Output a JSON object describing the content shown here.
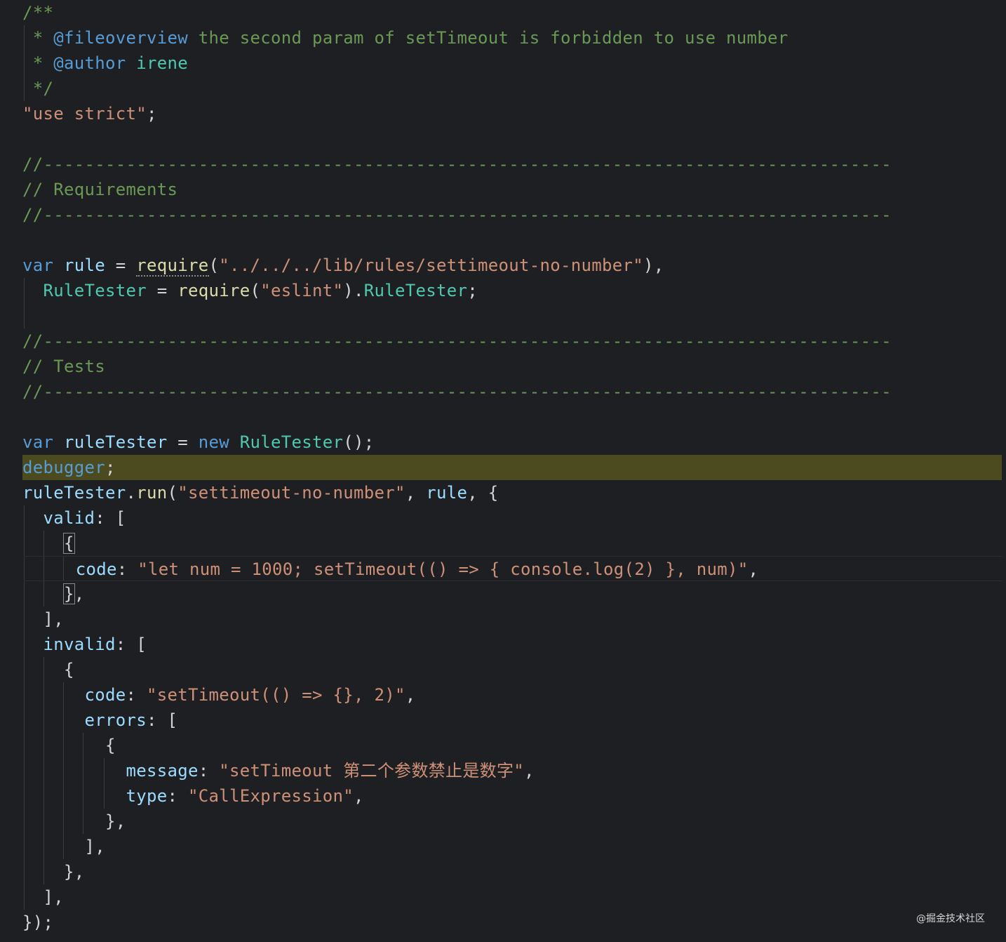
{
  "header_comment": {
    "open": "/**",
    "fileoverview_tag": "@fileoverview",
    "fileoverview_text": " the second param of setTimeout is forbidden to use number",
    "author_tag": "@author",
    "author_text": " irene",
    "close": " */"
  },
  "use_strict": "\"use strict\"",
  "separator": "//----------------------------------------------------------------------------------",
  "section_requirements": "// Requirements",
  "section_tests": "// Tests",
  "require_rule_path": "\"../../../lib/rules/settimeout-no-number\"",
  "require_eslint": "\"eslint\"",
  "rule_name": "\"settimeout-no-number\"",
  "valid_code": "\"let num = 1000; setTimeout(() => { console.log(2) }, num)\"",
  "invalid_code": "\"setTimeout(() => {}, 2)\"",
  "error_message": "\"setTimeout 第二个参数禁止是数字\"",
  "error_type": "\"CallExpression\"",
  "watermark": "@掘金技术社区",
  "colors": {
    "background": "#1e1f22",
    "comment": "#6a9955",
    "keyword": "#569cd6",
    "variable": "#9cdcfe",
    "class": "#4ec9b0",
    "function": "#dcdcaa",
    "string": "#ce9178",
    "number": "#b5cea8",
    "debug_highlight": "#4b4b1f"
  }
}
